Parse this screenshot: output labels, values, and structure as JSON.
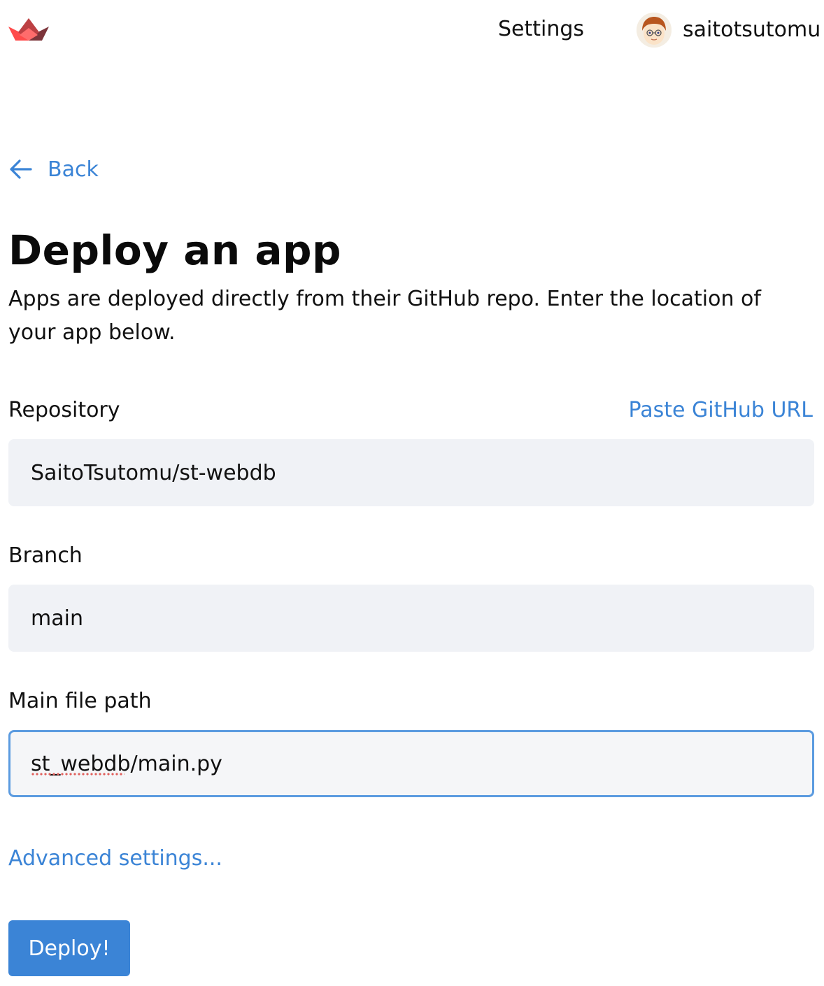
{
  "header": {
    "logo_icon": "streamlit-logo-icon",
    "settings_label": "Settings",
    "username": "saitotsutomu",
    "avatar_icon": "user-avatar"
  },
  "back": {
    "label": "Back",
    "icon": "arrow-left-icon"
  },
  "page": {
    "title": "Deploy an app",
    "description": "Apps are deployed directly from their GitHub repo. Enter the location of your app below."
  },
  "form": {
    "repository": {
      "label": "Repository",
      "value": "SaitoTsutomu/st-webdb",
      "paste_link": "Paste GitHub URL"
    },
    "branch": {
      "label": "Branch",
      "value": "main"
    },
    "main_file": {
      "label": "Main file path",
      "value": "st_webdb/main.py"
    },
    "advanced_label": "Advanced settings...",
    "deploy_label": "Deploy!"
  },
  "colors": {
    "accent": "#3b84d6",
    "input_bg": "#f0f2f6",
    "focus_border": "#5b9be0",
    "logo_red": "#ff4b4b",
    "logo_dark": "#7d353b"
  }
}
